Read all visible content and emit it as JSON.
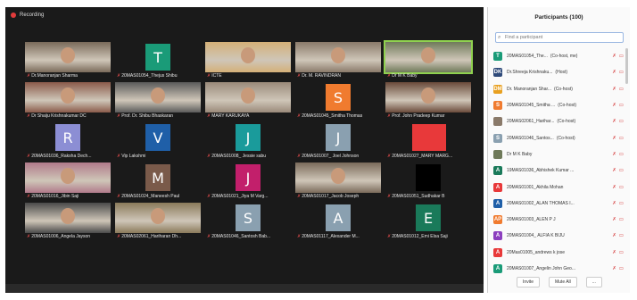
{
  "recording_label": "Recording",
  "tiles": [
    {
      "name": "Dr.Manoranjan Sharma",
      "kind": "photo",
      "color": "#7a6a5a",
      "active": false
    },
    {
      "name": "20MAS01054_Thejus Shibu",
      "kind": "letter",
      "letter": "T",
      "color": "#1a9b78",
      "active": false
    },
    {
      "name": "ICTE",
      "kind": "photo",
      "color": "#d4b078",
      "active": false
    },
    {
      "name": "Dr. M. RAVINDRAN",
      "kind": "photo",
      "color": "#8a7a6a",
      "active": false
    },
    {
      "name": "Dr M K Baby",
      "kind": "photo",
      "color": "#6f7a5a",
      "active": true
    },
    {
      "name": "Dr Shaiju Krishnakumar DC",
      "kind": "photo",
      "color": "#8a5a4a",
      "active": false
    },
    {
      "name": "Prof. Dr. Shibu Bhaskaran",
      "kind": "photo",
      "color": "#5a5a5a",
      "active": false
    },
    {
      "name": "MARY KARUKAYA",
      "kind": "photo",
      "color": "#9a8a7a",
      "active": false
    },
    {
      "name": "20MAS01045_Smitha Thomas",
      "kind": "letter",
      "letter": "S",
      "color": "#f07b2f",
      "active": false
    },
    {
      "name": "Prof. John Pradeep Kumar",
      "kind": "photo",
      "color": "#6a4a3a",
      "active": false
    },
    {
      "name": "20MAS01036_Raksha Dech...",
      "kind": "letter",
      "letter": "R",
      "color": "#8c8ed4",
      "active": false
    },
    {
      "name": "Vip Lakshmi",
      "kind": "letter",
      "letter": "V",
      "color": "#1f5fa8",
      "active": false
    },
    {
      "name": "20MAS01008_ Jessie sabu",
      "kind": "letter",
      "letter": "J",
      "color": "#1a9b9b",
      "active": false
    },
    {
      "name": "20MAS01007_ Joel Johnson",
      "kind": "letter",
      "letter": "J",
      "color": "#8aa0b0",
      "active": false
    },
    {
      "name": "20MAS01027_MARY MARG...",
      "kind": "red",
      "color": "#e8393a",
      "active": false
    },
    {
      "name": "20MAS01016_Jibin Saji",
      "kind": "photo",
      "color": "#b07a8a",
      "active": false
    },
    {
      "name": "20MAS01024_Maneesh Paul",
      "kind": "letter",
      "letter": "M",
      "color": "#7a5a4a",
      "active": false
    },
    {
      "name": "20MAS01021_Jiya M Varg...",
      "kind": "letter",
      "letter": "J",
      "color": "#c21f6b",
      "active": false
    },
    {
      "name": "20MAS01017_Jacob Joseph",
      "kind": "photo",
      "color": "#7a6a5a",
      "active": false
    },
    {
      "name": "20MAS01051_Sudhakar B",
      "kind": "blank",
      "color": "#000000",
      "active": false
    },
    {
      "name": "20MAS01006_Angela Jayson",
      "kind": "photo",
      "color": "#4a4a4a",
      "active": false
    },
    {
      "name": "20MAS02061_Hariharan Dh...",
      "kind": "photo",
      "color": "#8a7a5a",
      "active": false
    },
    {
      "name": "20MAS01046_Santosh Bab...",
      "kind": "letter",
      "letter": "S",
      "color": "#8aa0b0",
      "active": false
    },
    {
      "name": "20MAS01117_Alexander M...",
      "kind": "letter",
      "letter": "A",
      "color": "#8aa0b0",
      "active": false
    },
    {
      "name": "20MAS01012_Emi Elsa Saji",
      "kind": "letter",
      "letter": "E",
      "color": "#1a7a5a",
      "active": false
    }
  ],
  "panel": {
    "title": "Participants (100)",
    "search_placeholder": "Find a participant",
    "participants": [
      {
        "initials": "T",
        "color": "#1a9b78",
        "name": "20MAS01054_The...",
        "tag": "(Co-host, me)"
      },
      {
        "initials": "DK",
        "color": "#2f4a7a",
        "name": "Dr.Shreeja Krishnaku...",
        "tag": "(Host)"
      },
      {
        "initials": "DM",
        "color": "#e8a020",
        "name": "Dr. Manoranjan Shar...",
        "tag": "(Co-host)"
      },
      {
        "initials": "S",
        "color": "#f07b2f",
        "name": "20MAS01045_Smitha ...",
        "tag": "(Co-host)"
      },
      {
        "initials": "",
        "color": "#8a7a6a",
        "name": "20MAS02061_Harihar...",
        "tag": "(Co-host)"
      },
      {
        "initials": "S",
        "color": "#8aa0b0",
        "name": "20MAS01046_Santos...",
        "tag": "(Co-host)"
      },
      {
        "initials": "",
        "color": "#6f7a5a",
        "name": "Dr M K Baby",
        "tag": ""
      },
      {
        "initials": "A",
        "color": "#1a7a5a",
        "name": "19MAS01036_Abhishek Kumar ...",
        "tag": ""
      },
      {
        "initials": "A",
        "color": "#e8393a",
        "name": "20MAS01001_Akhila Mohan",
        "tag": ""
      },
      {
        "initials": "A",
        "color": "#1f5fa8",
        "name": "20MAS01002_ALAN THOMAS I...",
        "tag": ""
      },
      {
        "initials": "AP",
        "color": "#f07b2f",
        "name": "20MAS01003_ALEN P J",
        "tag": ""
      },
      {
        "initials": "A",
        "color": "#8c3fbf",
        "name": "20MAS01004_ ALFIA K BIJU",
        "tag": ""
      },
      {
        "initials": "A",
        "color": "#e8393a",
        "name": "20Mas01005_andrews k jose",
        "tag": ""
      },
      {
        "initials": "A",
        "color": "#1a9b78",
        "name": "20MAS01007_Angelin John Geo...",
        "tag": ""
      }
    ],
    "invite_label": "Invite",
    "mute_all_label": "Mute All",
    "more_label": "..."
  }
}
